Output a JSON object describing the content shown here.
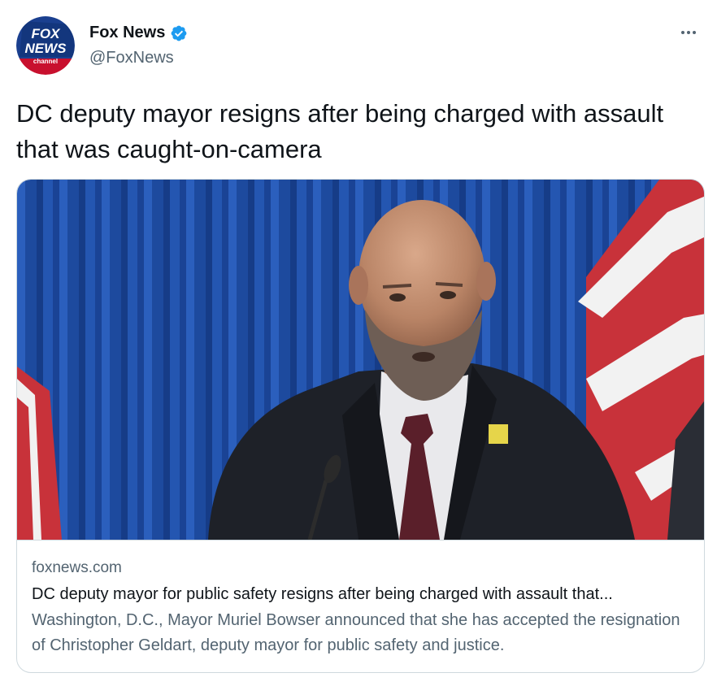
{
  "author": {
    "display_name": "Fox News",
    "handle": "@FoxNews",
    "verified": true,
    "avatar_text": [
      "FOX",
      "NEWS",
      "channel"
    ]
  },
  "tweet": {
    "text": "DC deputy mayor resigns after being charged with assault that was caught-on-camera"
  },
  "card": {
    "domain": "foxnews.com",
    "title": "DC deputy mayor for public safety resigns after being charged with assault that...",
    "description": "Washington, D.C., Mayor Muriel Bowser announced that she has accepted the resignation of Christopher Geldart, deputy mayor for public safety and justice."
  },
  "colors": {
    "text_primary": "#0f1419",
    "text_secondary": "#536471",
    "border": "#cfd9de",
    "verified_blue": "#1d9bf0",
    "curtain_blue": "#1f4fa6"
  },
  "icons": {
    "more": "more-horizontal-icon",
    "verified": "verified-badge-icon"
  }
}
